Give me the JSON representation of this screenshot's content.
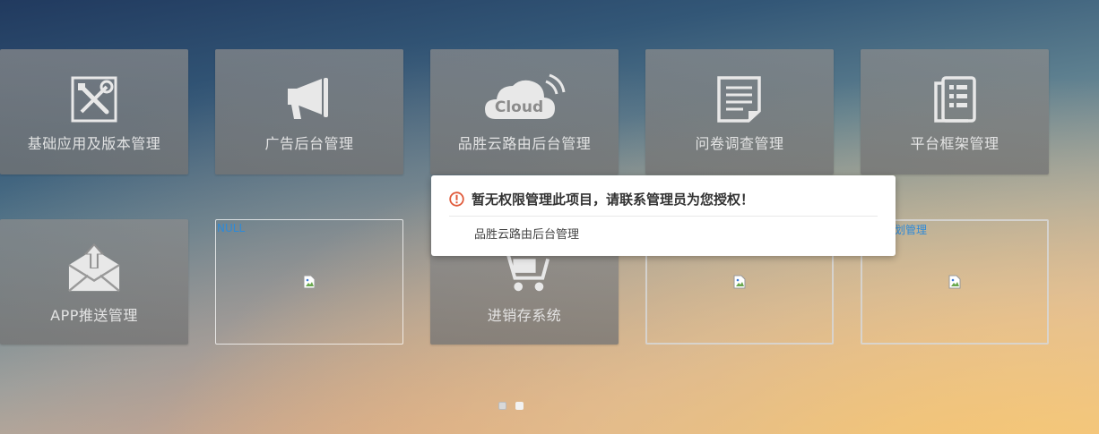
{
  "tiles": [
    {
      "label": "基础应用及版本管理",
      "icon": "tools-icon"
    },
    {
      "label": "广告后台管理",
      "icon": "megaphone-icon"
    },
    {
      "label": "品胜云路由后台管理",
      "icon": "cloud-icon",
      "icon_text": "Cloud"
    },
    {
      "label": "问卷调查管理",
      "icon": "document-icon"
    },
    {
      "label": "平台框架管理",
      "icon": "list-icon"
    },
    {
      "label": "APP推送管理",
      "icon": "mail-upload-icon"
    },
    {
      "corner_text": "NULL"
    },
    {
      "label": "进销存系统",
      "icon": "cart-icon"
    },
    {},
    {
      "corner_text": "划管理"
    }
  ],
  "popup": {
    "title": "暂无权限管理此项目，请联系管理员为您授权！",
    "body": "品胜云路由后台管理"
  },
  "pager": {
    "pages": 2,
    "active_index": 0
  },
  "colors": {
    "warning": "#e05a3a",
    "link_text": "#2e8ad8"
  }
}
